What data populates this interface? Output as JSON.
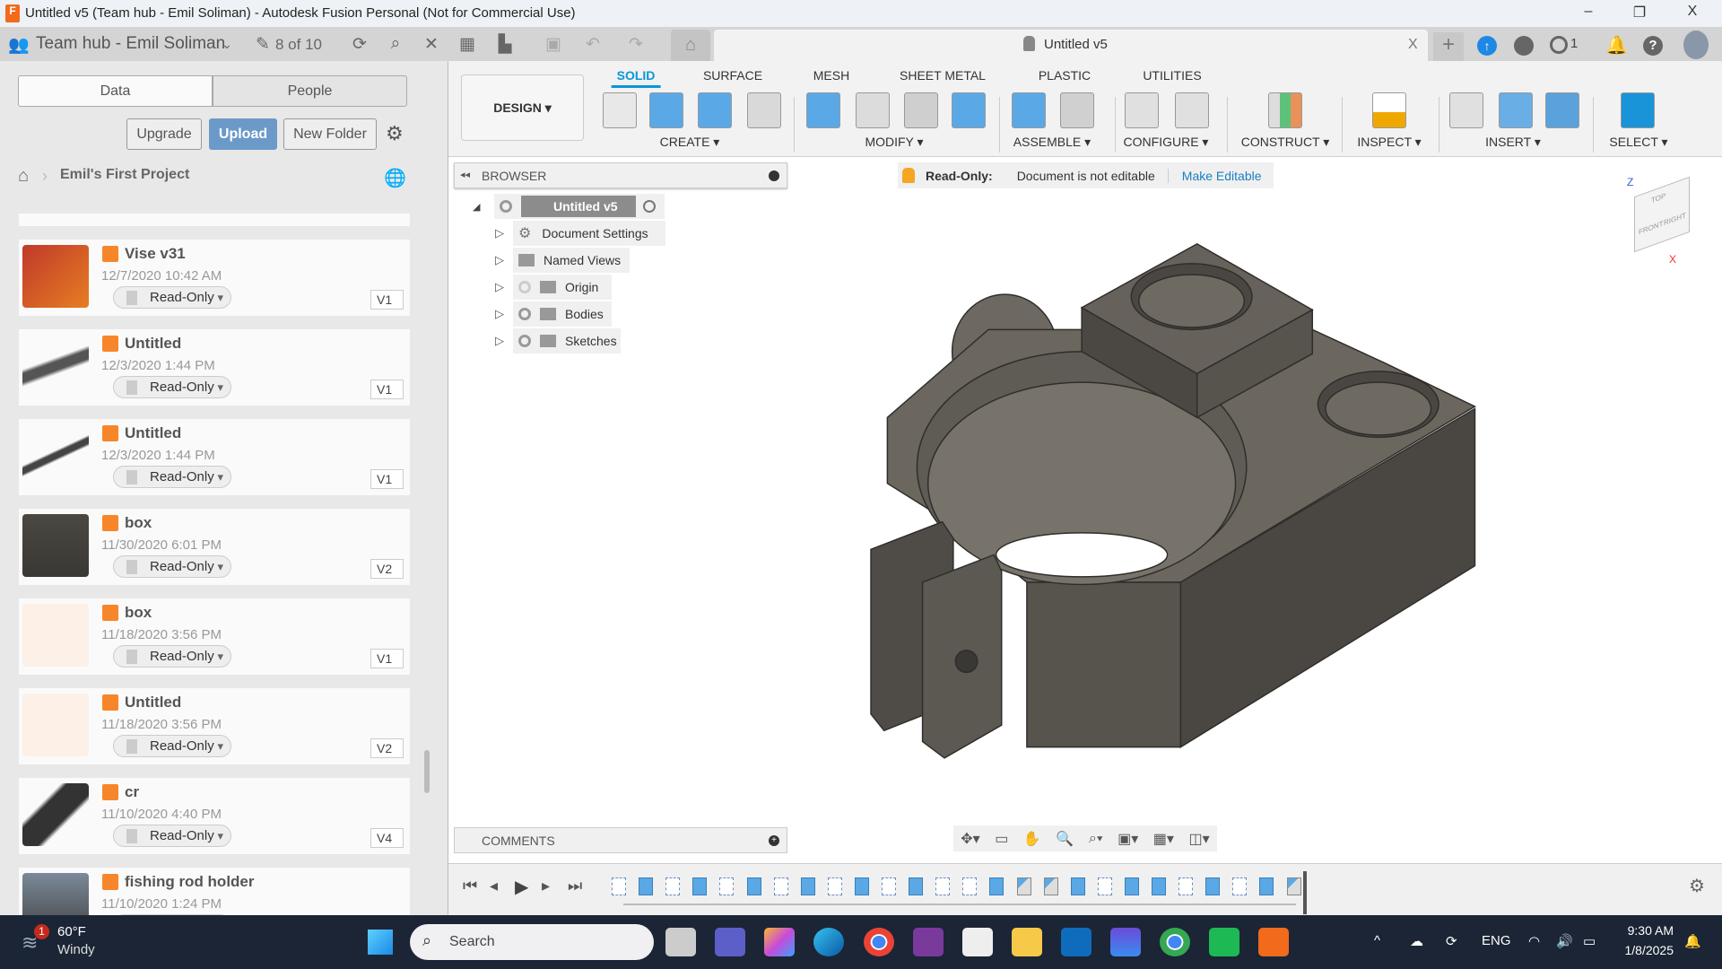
{
  "window": {
    "title": "Untitled v5 (Team hub - Emil Soliman) - Autodesk Fusion Personal (Not for Commercial Use)",
    "app_icon": "fusion-logo-icon",
    "minimize": "–",
    "restore": "❐",
    "close": "X"
  },
  "topbar": {
    "hub": "Team hub - Emil Soliman",
    "doc_count": "8 of 10",
    "doc_tab": "Untitled v5",
    "doc_tab_close": "X",
    "notification_count": "1",
    "new_tab": "+"
  },
  "data_panel": {
    "tabs": [
      "Data",
      "People"
    ],
    "buttons": {
      "upgrade": "Upgrade",
      "upload": "Upload",
      "new_folder": "New Folder"
    },
    "breadcrumb": "Emil's First Project",
    "files": [
      {
        "name": "Vise v31",
        "date": "12/7/2020 10:42 AM",
        "access": "Read-Only",
        "version": "V1"
      },
      {
        "name": "Untitled",
        "date": "12/3/2020 1:44 PM",
        "access": "Read-Only",
        "version": "V1"
      },
      {
        "name": "Untitled",
        "date": "12/3/2020 1:44 PM",
        "access": "Read-Only",
        "version": "V1"
      },
      {
        "name": "box",
        "date": "11/30/2020 6:01 PM",
        "access": "Read-Only",
        "version": "V2"
      },
      {
        "name": "box",
        "date": "11/18/2020 3:56 PM",
        "access": "Read-Only",
        "version": "V1"
      },
      {
        "name": "Untitled",
        "date": "11/18/2020 3:56 PM",
        "access": "Read-Only",
        "version": "V2"
      },
      {
        "name": "cr",
        "date": "11/10/2020 4:40 PM",
        "access": "Read-Only",
        "version": "V4"
      },
      {
        "name": "fishing rod holder",
        "date": "11/10/2020 1:24 PM",
        "access": "Read-Only",
        "version": ""
      }
    ]
  },
  "ribbon": {
    "workspace": "DESIGN ▾",
    "tabs": [
      "SOLID",
      "SURFACE",
      "MESH",
      "SHEET METAL",
      "PLASTIC",
      "UTILITIES"
    ],
    "active_tab": "SOLID",
    "groups": [
      "CREATE ▾",
      "MODIFY ▾",
      "ASSEMBLE ▾",
      "CONFIGURE ▾",
      "CONSTRUCT ▾",
      "INSPECT ▾",
      "INSERT ▾",
      "SELECT ▾"
    ],
    "icons": [
      "create-sketch-icon",
      "extrude-icon",
      "revolve-icon",
      "hole-icon",
      "press-pull-icon",
      "fillet-icon",
      "shell-icon",
      "combine-icon",
      "new-component-icon",
      "joint-icon",
      "configure-icon",
      "configure-table-icon",
      "offset-plane-icon",
      "measure-icon",
      "insert-derive-icon",
      "insert-mcmaster-icon",
      "insert-canvas-icon",
      "select-icon"
    ]
  },
  "browser": {
    "title": "BROWSER",
    "root": "Untitled v5",
    "items": [
      "Document Settings",
      "Named Views",
      "Origin",
      "Bodies",
      "Sketches"
    ]
  },
  "readonly_bar": {
    "label": "Read-Only:",
    "message": "Document is not editable",
    "action": "Make Editable"
  },
  "comments": {
    "title": "COMMENTS"
  },
  "viewcube": {
    "top": "TOP",
    "front": "FRONT",
    "right": "RIGHT",
    "axis_x": "X",
    "axis_z": "Z"
  },
  "timeline": {
    "features": [
      "sketch",
      "extrude",
      "sketch",
      "extrude",
      "sketch",
      "extrude",
      "sketch",
      "extrude",
      "sketch",
      "extrude",
      "sketch",
      "extrude",
      "sketch",
      "sketch",
      "extrude",
      "fillet",
      "fillet",
      "extrude",
      "sketch",
      "extrude",
      "extrude",
      "sketch",
      "extrude",
      "sketch",
      "extrude",
      "fillet"
    ]
  },
  "taskbar": {
    "weather_temp": "60°F",
    "weather_text": "Windy",
    "weather_badge": "1",
    "search": "Search",
    "language": "ENG",
    "time": "9:30 AM",
    "date": "1/8/2025"
  },
  "colors": {
    "accent": "#0a96d8",
    "upload": "#6b9ac9",
    "taskbar": "#1b2536",
    "model": "#5a5650"
  }
}
